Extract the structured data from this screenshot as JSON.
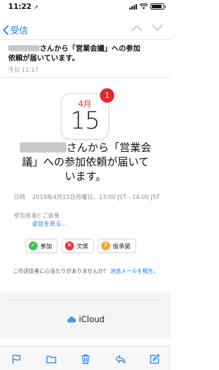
{
  "status_bar": {
    "time": "11:22",
    "location_glyph": "➚",
    "battery_level": 0.9
  },
  "nav": {
    "back_label": "受信",
    "icons": [
      "chevron-left-icon",
      "chevron-up-icon",
      "chevron-down-icon"
    ]
  },
  "mail": {
    "subject_suffix": "さんから「営業会議」への参加",
    "subject_line2": "依頼が届いています。",
    "date": "今日 11:17"
  },
  "calendar_icon": {
    "month": "4月",
    "day": "15",
    "badge": "1"
  },
  "invite": {
    "title_part1": "さんから「営業会",
    "title_part2": "議」への参加依頼が届いて",
    "title_part3": "います。"
  },
  "details": {
    "time_label": "日時",
    "time_value": "2019年4月15日月曜日、13:00 JST - 14:00 JST",
    "attendee_label": "参加者",
    "attendee_value": "とご自身",
    "reply_link": "返信を見る..."
  },
  "responses": {
    "accept": "参加",
    "decline": "欠席",
    "maybe": "仮承諾"
  },
  "colors": {
    "accent": "#1a7cf5",
    "badge_red": "#e6262b",
    "accept_green": "#34c759",
    "decline_red": "#e63737",
    "maybe_orange": "#f5a623"
  },
  "sender_note": {
    "question": "この送信者に心当たりがありませんか？",
    "report_link": "迷惑メールを報告。"
  },
  "footer": {
    "brand": "iCloud"
  },
  "toolbar": {
    "icons": [
      "flag-icon",
      "folder-icon",
      "trash-icon",
      "reply-icon",
      "compose-icon"
    ]
  }
}
